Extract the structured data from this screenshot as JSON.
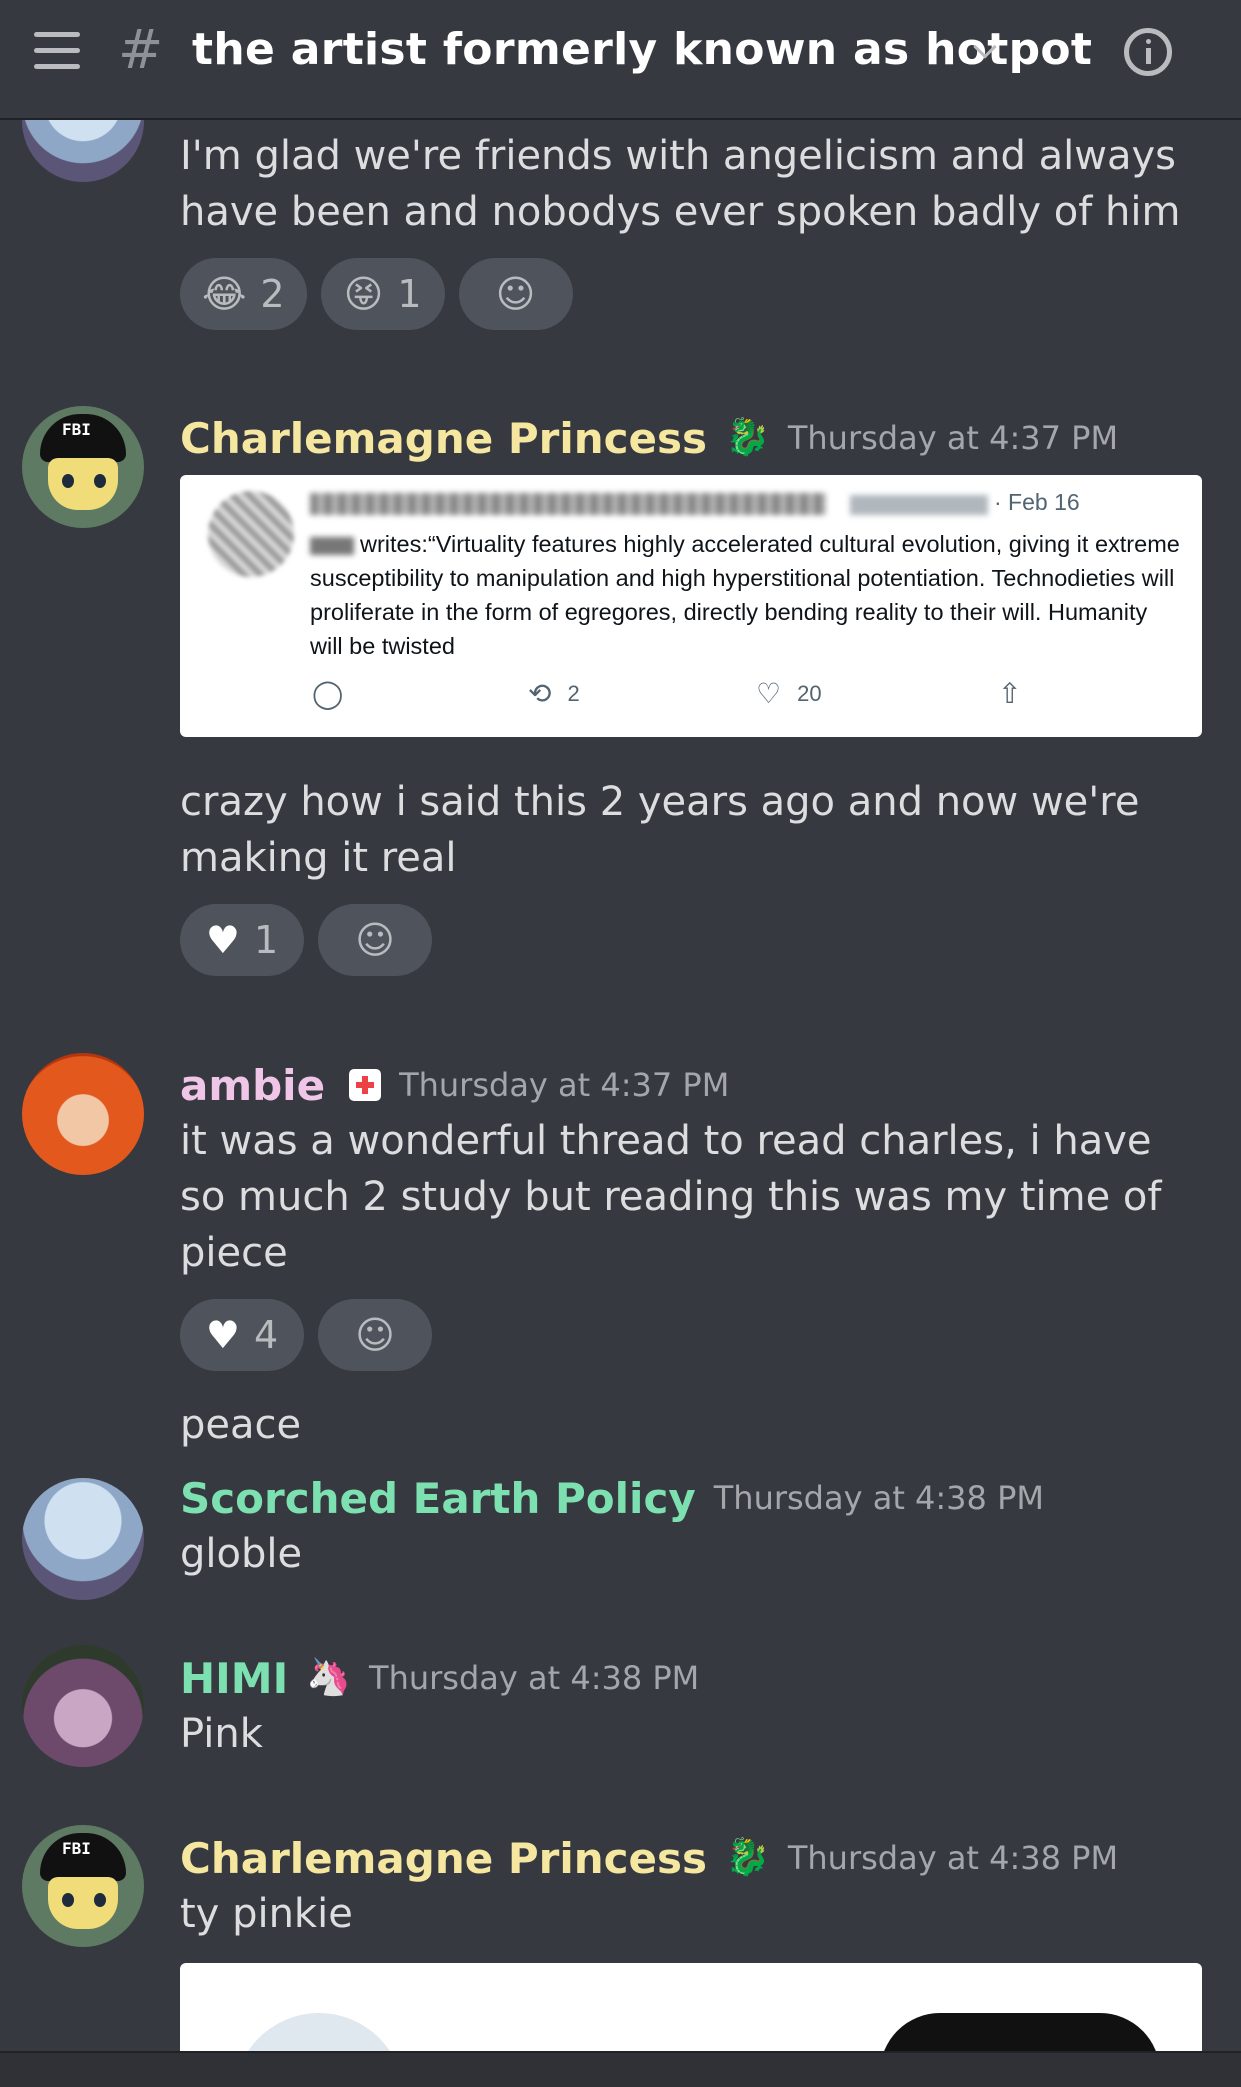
{
  "header": {
    "channel_name": "the artist formerly known as hotpot"
  },
  "messages": [
    {
      "text": "I'm glad we're friends with angelicism and always have been and nobodys ever spoken badly of him",
      "reactions": [
        {
          "emoji": "😂",
          "count": "2"
        },
        {
          "emoji": "😝",
          "count": "1"
        }
      ]
    },
    {
      "author": "Charlemagne Princess",
      "author_color": "#f5e6a0",
      "badge": "🐉",
      "timestamp": "Thursday at 4:37 PM",
      "embed": {
        "date": "· Feb 16",
        "more": "•••",
        "author_suffix": "writes:",
        "body": "“Virtuality features highly accelerated cultural evolution, giving it extreme susceptibility to manipulation and high hyperstitional potentiation. Technodieties will proliferate in the form of egregores, directly bending reality to their will. Humanity will be twisted",
        "retweets": "2",
        "likes": "20"
      },
      "text": "crazy how i said this 2 years ago and now we're making it real",
      "reactions": [
        {
          "emoji": "♥",
          "count": "1"
        }
      ]
    },
    {
      "author": "ambie",
      "author_color": "#f0c6e8",
      "timestamp": "Thursday at 4:37 PM",
      "text": "it was a wonderful thread to read charles, i have so much 2 study but reading this was my time of piece",
      "reactions": [
        {
          "emoji": "♥",
          "count": "4"
        }
      ],
      "followup": "peace"
    },
    {
      "author": "Scorched Earth Policy",
      "author_color": "#7de0b1",
      "timestamp": "Thursday at 4:38 PM",
      "text": "globle"
    },
    {
      "author": "HIMI",
      "author_color": "#7de0b1",
      "badge": "🦄",
      "timestamp": "Thursday at 4:38 PM",
      "text": "Pink"
    },
    {
      "author": "Charlemagne Princess",
      "author_color": "#f5e6a0",
      "badge": "🐉",
      "timestamp": "Thursday at 4:38 PM",
      "text": "ty pinkie"
    }
  ],
  "icons": {
    "add_reaction": "☺",
    "reply": "◯",
    "retweet": "⟲",
    "like": "♡",
    "share": "⇧",
    "fbi_cap_text": "FBI"
  }
}
